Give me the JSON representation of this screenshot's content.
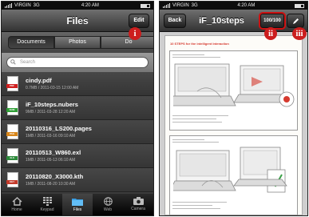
{
  "left_screen": {
    "status": {
      "carrier": "VIRGIN",
      "network": "3G",
      "time": "4:20 AM"
    },
    "nav": {
      "title": "Files",
      "edit_label": "Edit"
    },
    "marker_label": "i",
    "segments": [
      {
        "label": "Documents",
        "selected": true
      },
      {
        "label": "Photos",
        "selected": false
      },
      {
        "label": "Do",
        "selected": false
      }
    ],
    "search": {
      "placeholder": "Search"
    },
    "files": [
      {
        "name": "cindy.pdf",
        "meta": "0.7MB  /  2011-03-15 12:00 AM",
        "type": "pdf",
        "icon": "pdf-file-icon"
      },
      {
        "name": "iF_10steps.nubers",
        "meta": "9MB  /  2011-03-28 12:20 AM",
        "type": "numbers",
        "icon": "numbers-file-icon"
      },
      {
        "name": "20110316_LS200.pages",
        "meta": "1MB  /  2011-03-16 09:10 AM",
        "type": "pages",
        "icon": "pages-file-icon"
      },
      {
        "name": "20110513_W860.exl",
        "meta": "1MB  /  2011-05-13 06:10 AM",
        "type": "xls",
        "icon": "excel-file-icon"
      },
      {
        "name": "20110820_X3000.kth",
        "meta": "1MB  /  2011-08-20 10:30 AM",
        "type": "key",
        "icon": "keynote-file-icon"
      }
    ],
    "tabs": [
      {
        "label": "Home",
        "icon": "home-icon",
        "active": false
      },
      {
        "label": "Keypad",
        "icon": "keypad-icon",
        "active": false
      },
      {
        "label": "Files",
        "icon": "folder-icon",
        "active": true
      },
      {
        "label": "Web",
        "icon": "globe-icon",
        "active": false
      },
      {
        "label": "Camera",
        "icon": "camera-icon",
        "active": false
      }
    ]
  },
  "right_screen": {
    "status": {
      "carrier": "VIRGIN",
      "network": "3G",
      "time": "4:20 AM"
    },
    "nav": {
      "back_label": "Back",
      "title": "iF_10steps",
      "page_counter": "100/100",
      "edit_icon": "pencil-icon"
    },
    "markers": [
      "ii",
      "iii"
    ],
    "document": {
      "heading": "10 STEPS for the intelligent Interaction"
    }
  },
  "colors": {
    "marker": "#cc1e1e",
    "navbar": "#333333",
    "doc_heading": "#d63a2f"
  }
}
